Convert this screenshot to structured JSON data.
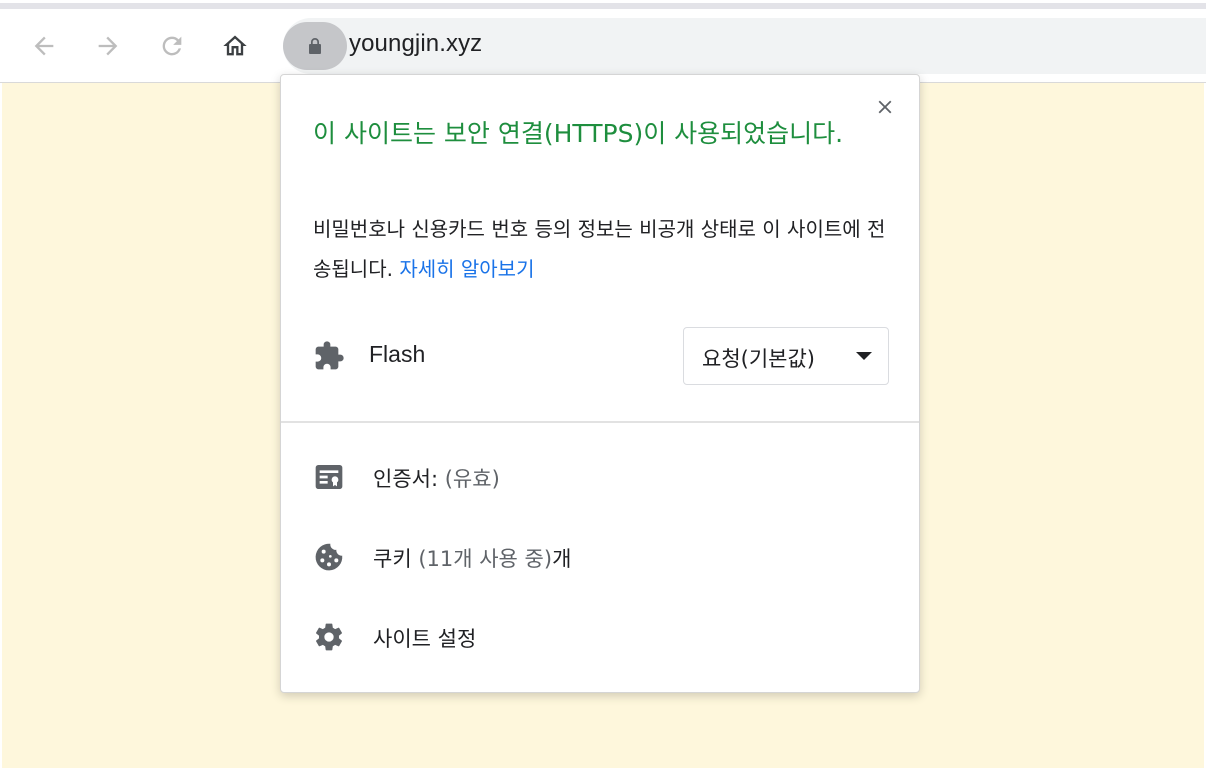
{
  "browser": {
    "url": "youngjin.xyz",
    "back_icon": "arrow-left-icon",
    "forward_icon": "arrow-right-icon",
    "reload_icon": "reload-icon",
    "home_icon": "home-icon",
    "lock_icon": "lock-icon"
  },
  "popup": {
    "title": "이 사이트는 보안 연결(HTTPS)이 사용되었습니다.",
    "description": "비밀번호나 신용카드 번호 등의 정보는 비공개 상태로 이 사이트에 전송됩니다.",
    "learn_more": "자세히 알아보기",
    "close_icon": "close-icon",
    "permission": {
      "icon": "puzzle-icon",
      "label": "Flash",
      "value": "요청(기본값)"
    },
    "items": [
      {
        "icon": "certificate-icon",
        "label": "인증서:",
        "sub": "(유효)",
        "suffix": ""
      },
      {
        "icon": "cookie-icon",
        "label": "쿠키",
        "sub": "(11개 사용 중)",
        "suffix": "개"
      },
      {
        "icon": "gear-icon",
        "label": "사이트 설정",
        "sub": "",
        "suffix": ""
      }
    ]
  },
  "colors": {
    "secure_green": "#1e8e3e",
    "link_blue": "#1a73e8",
    "page_background": "#fef7dc"
  }
}
